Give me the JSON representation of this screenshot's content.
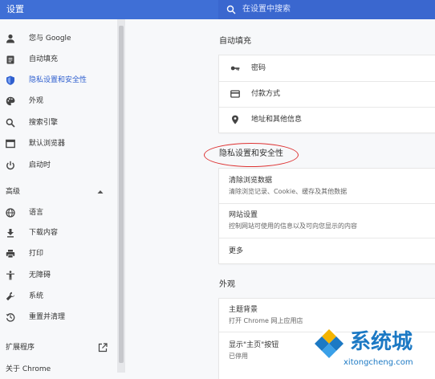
{
  "app": {
    "title": "设置"
  },
  "search": {
    "placeholder": "在设置中搜索"
  },
  "sidebar": {
    "items": [
      {
        "label": "您与 Google",
        "icon": "person-icon"
      },
      {
        "label": "自动填充",
        "icon": "clipboard-icon"
      },
      {
        "label": "隐私设置和安全性",
        "icon": "shield-icon",
        "active": true
      },
      {
        "label": "外观",
        "icon": "palette-icon"
      },
      {
        "label": "搜索引擎",
        "icon": "search-icon"
      },
      {
        "label": "默认浏览器",
        "icon": "browser-icon"
      },
      {
        "label": "启动时",
        "icon": "power-icon"
      }
    ],
    "advanced_label": "高级",
    "advanced_items": [
      {
        "label": "语言",
        "icon": "globe-icon"
      },
      {
        "label": "下载内容",
        "icon": "download-icon"
      },
      {
        "label": "打印",
        "icon": "printer-icon"
      },
      {
        "label": "无障碍",
        "icon": "accessibility-icon"
      },
      {
        "label": "系统",
        "icon": "wrench-icon"
      },
      {
        "label": "重置并清理",
        "icon": "history-icon"
      }
    ],
    "extensions_label": "扩展程序",
    "about_label": "关于 Chrome"
  },
  "autofill": {
    "title": "自动填充",
    "rows": [
      {
        "label": "密码",
        "icon": "key-icon"
      },
      {
        "label": "付款方式",
        "icon": "credit-card-icon"
      },
      {
        "label": "地址和其他信息",
        "icon": "location-pin-icon"
      }
    ]
  },
  "privacy": {
    "title": "隐私设置和安全性",
    "rows": [
      {
        "title": "清除浏览数据",
        "sub": "清除浏览记录、Cookie、缓存及其他数据"
      },
      {
        "title": "网站设置",
        "sub": "控制网站可使用的信息以及可向您显示的内容"
      }
    ],
    "more_label": "更多"
  },
  "appearance": {
    "title": "外观",
    "rows": [
      {
        "title": "主题背景",
        "sub": "打开 Chrome 网上应用店"
      },
      {
        "title": "显示\"主页\"按钮",
        "sub": "已停用"
      }
    ]
  },
  "watermark": {
    "big": "系统城",
    "small": "xitongcheng.com"
  },
  "colors": {
    "header": "#3f6fd6",
    "accent": "#2f5fcf",
    "annotation": "#dd3333",
    "watermark": "#1c79c4"
  }
}
